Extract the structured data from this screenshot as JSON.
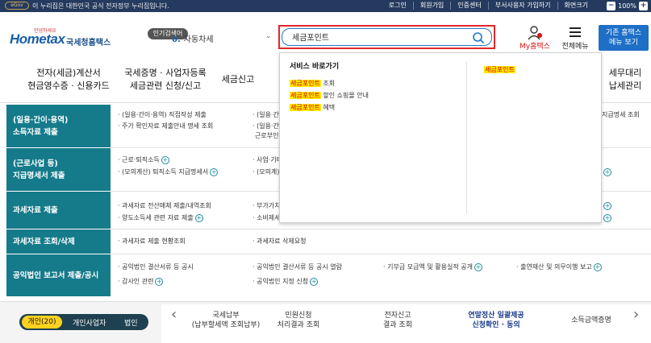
{
  "topbar": {
    "gov_badge": "eGov",
    "message": "이 누리집은 대한민국 공식 전자정부 누리집입니다.",
    "links": [
      "로그인",
      "회원가입",
      "인증센터",
      "부서사용자 가입하기",
      "화면크기"
    ],
    "zoom_minus": "−",
    "zoom_value": "100%",
    "zoom_plus": "+"
  },
  "header": {
    "logo_small": "안녕하세요",
    "logo_text": "Hometax",
    "logo_kr": "국세청홈택스",
    "popular_label": "인기검색어",
    "rank_num": "6.",
    "rank_term": "자동차세",
    "search_value": "세금포인트",
    "my_hometax": "My홈택스",
    "all_menu": "전체메뉴",
    "basic_line1": "기존 홈택스",
    "basic_line2": "메뉴 보기"
  },
  "mainmenu": [
    {
      "l1": "전자(세금)계산서",
      "l2": "현금영수증 · 신용카드"
    },
    {
      "l1": "국세증명 · 사업자등록",
      "l2": "세금관련 신청/신고"
    },
    {
      "l1": "세금신고",
      "l2": ""
    },
    {
      "l1": "세무대리",
      "l2": "납세관리"
    }
  ],
  "sections": [
    {
      "title1": "(일용·간이·용역)",
      "title2": "소득자료 제출",
      "items": [
        "· (일용·간이·용역) 직접작성 제출",
        "· 주가 확인자료 제출안내 명세 조회",
        "· (일용·간이",
        "· (일용·간이",
        "근로부인",
        "지급명세 조회"
      ]
    },
    {
      "title1": "(근로사업 등)",
      "title2": "지급명세서 제출",
      "items": [
        "· 근로·퇴직소득",
        "· (모의계산) 퇴직소득 지급명세서",
        "· 사업·기타",
        "· (모의계)"
      ]
    },
    {
      "title1": "과세자료 제출",
      "title2": "",
      "items": [
        "· 과세자료 전산매체 제출/내역조회",
        "· 양도소득세 관련 자료 제출",
        "· 부가가치",
        "· 소비제세"
      ]
    },
    {
      "title1": "과세자료 조회/삭제",
      "title2": "",
      "items": [
        "· 과세자료 제출 현황조회",
        "· 과세자료 삭제요청"
      ]
    },
    {
      "title1": "공익법인 보고서 제출/공시",
      "title2": "",
      "items": [
        "· 공익법인 결산서류 등 공시",
        "· 감사인 관련",
        "· 공익법인 결산서류 등 공시 열람",
        "· 공익법인 지정 신청",
        "· 기부금 모금액 및 활용실적 공개",
        "· 출연재산 및 의무이행 보고"
      ]
    }
  ],
  "dropdown": {
    "title": "서비스 바로가기",
    "items": [
      {
        "hl": "세금포인트",
        "rest": " 조회"
      },
      {
        "hl": "세금포인트",
        "rest": " 할인 쇼핑몰 안내"
      },
      {
        "hl": "세금포인트",
        "rest": " 혜택"
      }
    ],
    "right_hl": "세금포인트"
  },
  "bottom": {
    "segments": [
      "개인(20)",
      "개인사업자",
      "법인"
    ],
    "tabs": [
      {
        "l1": "국세납부",
        "l2": "(납부할세액 조회납부)"
      },
      {
        "l1": "민원신청",
        "l2": "처리결과 조회"
      },
      {
        "l1": "전자신고",
        "l2": "결과 조회"
      },
      {
        "l1": "연말정산 일괄제공",
        "l2": "신청확인 · 동의"
      },
      {
        "l1": "소득금액증명",
        "l2": ""
      }
    ]
  }
}
